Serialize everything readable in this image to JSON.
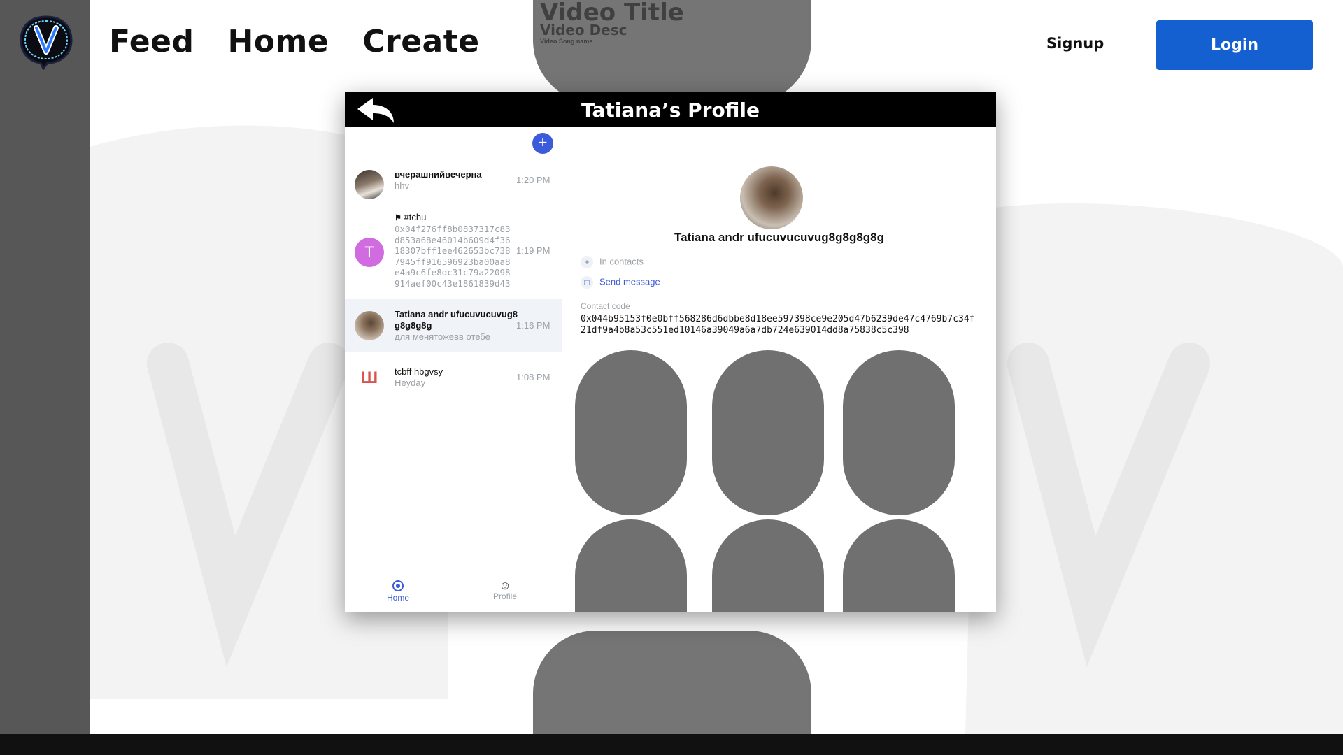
{
  "nav": {
    "feed": "Feed",
    "home": "Home",
    "create": "Create"
  },
  "video": {
    "title": "Video Title",
    "desc": "Video Desc",
    "song": "Video Song name"
  },
  "auth": {
    "signup": "Signup",
    "login": "Login"
  },
  "modal": {
    "title": "Tatiana’s Profile",
    "chats": [
      {
        "name": "вчерашнийвечерна",
        "message": "hhv",
        "time": "1:20 PM"
      },
      {
        "name": "#tchu",
        "message": "0x04f276ff8b0837317c83d853a68e46014b609d4f3618307bff1ee462653bc7387945ff916596923ba00aa8e4a9c6fe8dc31c79a22098914aef00c43e1861839d43",
        "time": "1:19 PM",
        "avatar_letter": "T"
      },
      {
        "name": "Tatiana andr ufucuvucuvug8g8g8g8g",
        "message": "для менятожевв отебе",
        "time": "1:16 PM"
      },
      {
        "name": "tcbff hbgvsy",
        "message": "Heyday",
        "time": "1:08 PM",
        "avatar_letter": "Ш"
      }
    ],
    "tabs": {
      "home": "Home",
      "profile": "Profile"
    },
    "profile": {
      "name": "Tatiana andr ufucuvucuvug8g8g8g8g",
      "in_contacts": "In contacts",
      "send_message": "Send message",
      "contact_label": "Contact code",
      "contact_code": "0x044b95153f0e0bff568286d6dbbe8d18ee597398ce9e205d47b6239de47c4769b7c34f21df9a4b8a53c551ed10146a39049a6a7db724e639014dd8a75838c5c398"
    }
  },
  "colors": {
    "accent": "#3b5bdb",
    "login": "#1560d1",
    "sidebar": "#575757"
  }
}
